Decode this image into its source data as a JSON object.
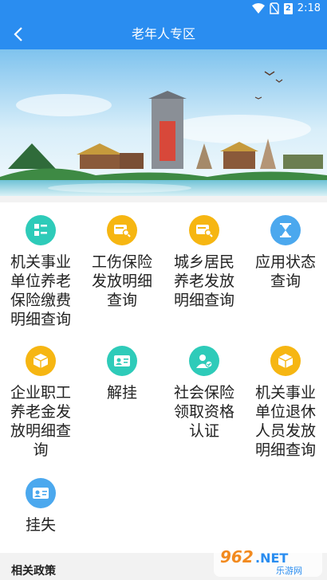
{
  "status_bar": {
    "time": "2:18",
    "battery": "2"
  },
  "header": {
    "title": "老年人专区"
  },
  "services": [
    {
      "label": "机关事业单位养老保险缴费明细查询",
      "icon": "list-icon",
      "color": "#2ecbb9"
    },
    {
      "label": "工伤保险发放明细查询",
      "icon": "card-search-icon",
      "color": "#f6b612"
    },
    {
      "label": "城乡居民养老发放明细查询",
      "icon": "card-search-icon",
      "color": "#f6b612"
    },
    {
      "label": "应用状态查询",
      "icon": "hourglass-icon",
      "color": "#4ba8ee"
    },
    {
      "label": "企业职工养老金发放明细查询",
      "icon": "box-icon",
      "color": "#f6b612"
    },
    {
      "label": "解挂",
      "icon": "id-card-icon",
      "color": "#2ecbb9"
    },
    {
      "label": "社会保险领取资格认证",
      "icon": "person-check-icon",
      "color": "#2ecbb9"
    },
    {
      "label": "机关事业单位退休人员发放明细查询",
      "icon": "box-icon",
      "color": "#f6b612"
    },
    {
      "label": "挂失",
      "icon": "id-card-icon",
      "color": "#4ba8ee"
    }
  ],
  "policy_section": {
    "title": "相关政策"
  },
  "watermark": {
    "brand": "962.NET",
    "sub": "乐游网"
  },
  "colors": {
    "primary": "#2a8df0",
    "teal": "#2ecbb9",
    "amber": "#f6b612",
    "blue": "#4ba8ee"
  }
}
